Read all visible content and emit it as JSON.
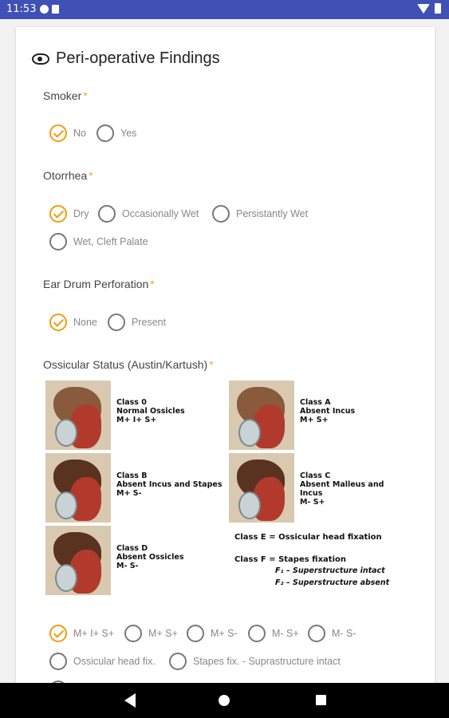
{
  "status_bar": {
    "time": "11:53"
  },
  "card": {
    "title": "Peri-operative Findings",
    "required_marker": "*"
  },
  "questions": [
    {
      "label": "Smoker",
      "options": [
        {
          "label": "No",
          "checked": true
        },
        {
          "label": "Yes",
          "checked": false
        }
      ]
    },
    {
      "label": "Otorrhea",
      "options": [
        {
          "label": "Dry",
          "checked": true
        },
        {
          "label": "Occasionally Wet",
          "checked": false
        },
        {
          "label": "Persistantly Wet",
          "checked": false
        },
        {
          "label": "Wet, Cleft Palate",
          "checked": false
        }
      ]
    },
    {
      "label": "Ear Drum Perforation",
      "options": [
        {
          "label": "None",
          "checked": true
        },
        {
          "label": "Present",
          "checked": false
        }
      ]
    },
    {
      "label": "Ossicular Status (Austin/Kartush)",
      "options": [
        {
          "label": "M+ I+ S+",
          "checked": true
        },
        {
          "label": "M+ S+",
          "checked": false
        },
        {
          "label": "M+ S-",
          "checked": false
        },
        {
          "label": "M- S+",
          "checked": false
        },
        {
          "label": "M- S-",
          "checked": false
        },
        {
          "label": "Ossicular head fix.",
          "checked": false
        },
        {
          "label": "Stapes fix. - Suprastructure intact",
          "checked": false
        }
      ]
    }
  ],
  "figure": {
    "class0": {
      "title": "Class 0",
      "desc": "Normal Ossicles",
      "code": "M+ I+ S+"
    },
    "classA": {
      "title": "Class A",
      "desc": "Absent Incus",
      "code": "M+ S+"
    },
    "classB": {
      "title": "Class B",
      "desc": "Absent Incus and Stapes",
      "code": "M+ S-"
    },
    "classC": {
      "title": "Class C",
      "desc": "Absent Malleus and Incus",
      "code": "M- S+"
    },
    "classD": {
      "title": "Class D",
      "desc": "Absent Ossicles",
      "code": "M- S-"
    },
    "classE": "Class E = Ossicular head fixation",
    "classF": "Class F = Stapes fixation",
    "f1": "F₁ – Superstructure intact",
    "f2": "F₂ – Superstructure absent"
  },
  "colors": {
    "status_bar": "#3f51b5",
    "accent": "#f39c12",
    "required": "#f5a623"
  }
}
